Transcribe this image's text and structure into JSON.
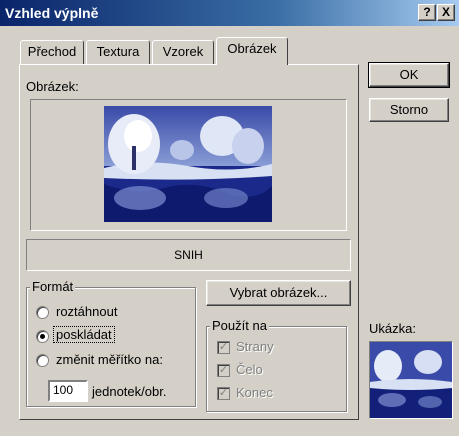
{
  "window": {
    "title": "Vzhled výplně",
    "help_label": "?",
    "close_label": "X"
  },
  "tabs": [
    {
      "label": "Přechod",
      "active": false
    },
    {
      "label": "Textura",
      "active": false
    },
    {
      "label": "Vzorek",
      "active": false
    },
    {
      "label": "Obrázek",
      "active": true
    }
  ],
  "buttons": {
    "ok": "OK",
    "cancel": "Storno",
    "choose_picture": "Vybrat obrázek..."
  },
  "picture": {
    "label": "Obrázek:",
    "name": "SNIH",
    "icon": "snowy-landscape-image"
  },
  "format": {
    "label": "Formát",
    "options": [
      {
        "label": "roztáhnout",
        "checked": false
      },
      {
        "label": "poskládat",
        "checked": true
      },
      {
        "label": "změnit měřítko na:",
        "checked": false
      }
    ],
    "scale_value": "100",
    "scale_unit": "jednotek/obr."
  },
  "apply": {
    "label": "Použít na",
    "items": [
      {
        "label": "Strany",
        "checked": true
      },
      {
        "label": "Čelo",
        "checked": true
      },
      {
        "label": "Konec",
        "checked": true
      }
    ]
  },
  "preview": {
    "label": "Ukázka:"
  }
}
